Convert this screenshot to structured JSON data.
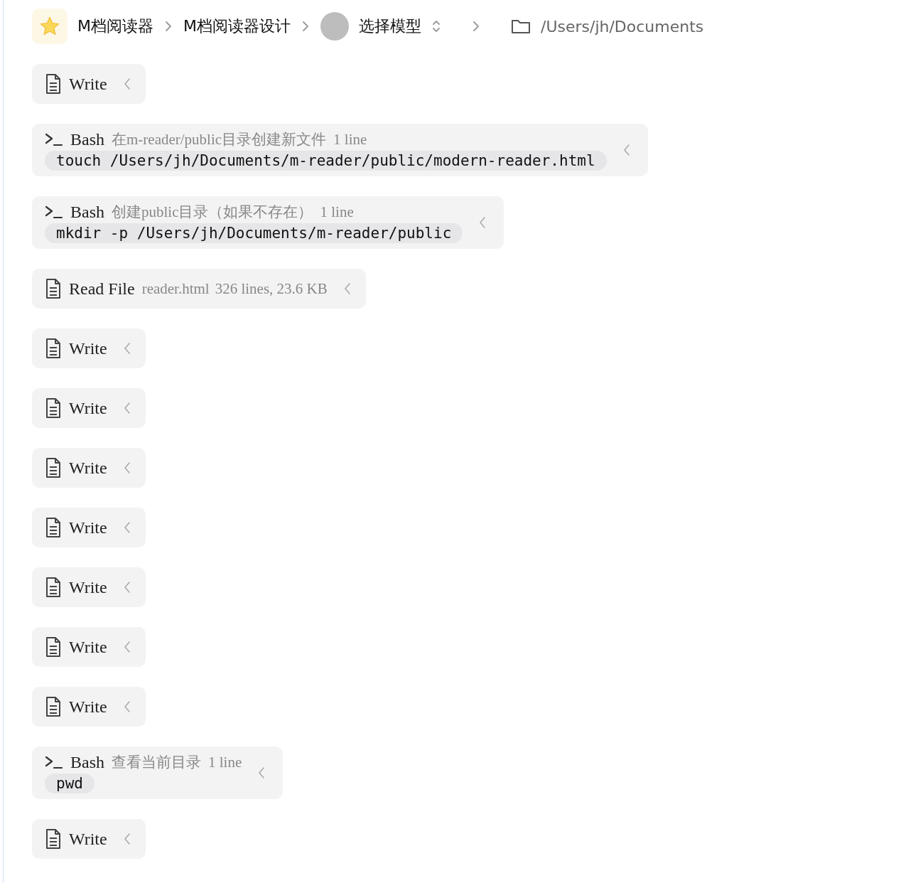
{
  "breadcrumb": {
    "items": [
      "M档阅读器",
      "M档阅读器设计"
    ],
    "model": "选择模型",
    "path": "/Users/jh/Documents"
  },
  "entries": [
    {
      "kind": "write",
      "title": "Write"
    },
    {
      "kind": "bash",
      "title": "Bash",
      "description": "在m-reader/public目录创建新文件",
      "meta": "1 line",
      "command": "touch /Users/jh/Documents/m-reader/public/modern-reader.html"
    },
    {
      "kind": "bash",
      "title": "Bash",
      "description": "创建public目录（如果不存在）",
      "meta": "1 line",
      "command": "mkdir -p /Users/jh/Documents/m-reader/public"
    },
    {
      "kind": "read",
      "title": "Read File",
      "file": "reader.html",
      "meta": "326 lines, 23.6 KB"
    },
    {
      "kind": "write",
      "title": "Write"
    },
    {
      "kind": "write",
      "title": "Write"
    },
    {
      "kind": "write",
      "title": "Write"
    },
    {
      "kind": "write",
      "title": "Write"
    },
    {
      "kind": "write",
      "title": "Write"
    },
    {
      "kind": "write",
      "title": "Write"
    },
    {
      "kind": "write",
      "title": "Write"
    },
    {
      "kind": "bash",
      "title": "Bash",
      "description": "查看当前目录",
      "meta": "1 line",
      "command": "pwd"
    },
    {
      "kind": "write",
      "title": "Write"
    }
  ]
}
